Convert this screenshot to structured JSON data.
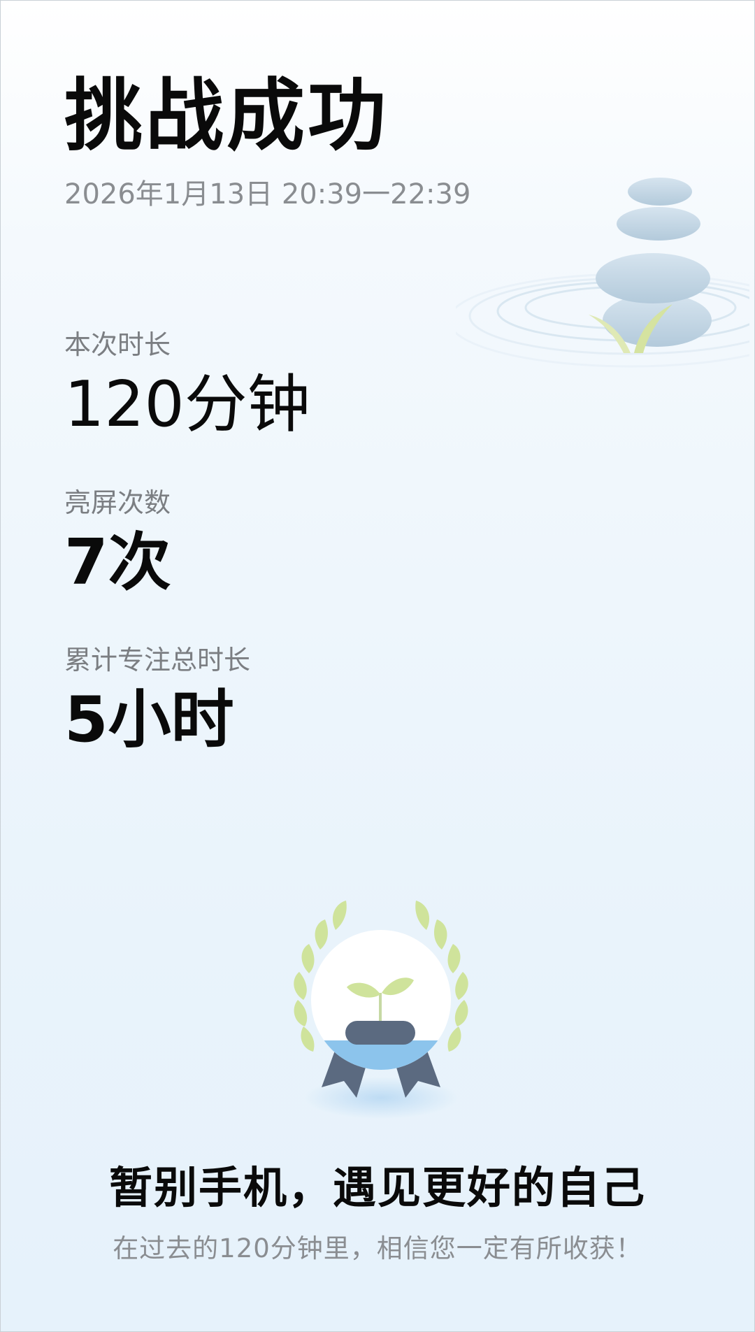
{
  "header": {
    "title": "挑战成功",
    "datetime": "2026年1月13日 20:39一22:39"
  },
  "stats": {
    "duration": {
      "label": "本次时长",
      "value": "120分钟"
    },
    "screen_on": {
      "label": "亮屏次数",
      "value": "7次"
    },
    "total_focus": {
      "label": "累计专注总时长",
      "value": "5小时"
    }
  },
  "footer": {
    "slogan": "暂别手机，遇见更好的自己",
    "subtext": "在过去的120分钟里，相信您一定有所收获！"
  },
  "illustrations": {
    "top_right": "stacked-stones-icon",
    "badge": "sprout-medal-icon"
  },
  "colors": {
    "title": "#0a0a0a",
    "label": "#7b7e82",
    "leaf": "#c9e08f",
    "stone": "#b8cfdf",
    "water": "#8cc4ec",
    "ribbon": "#5b6a80"
  }
}
